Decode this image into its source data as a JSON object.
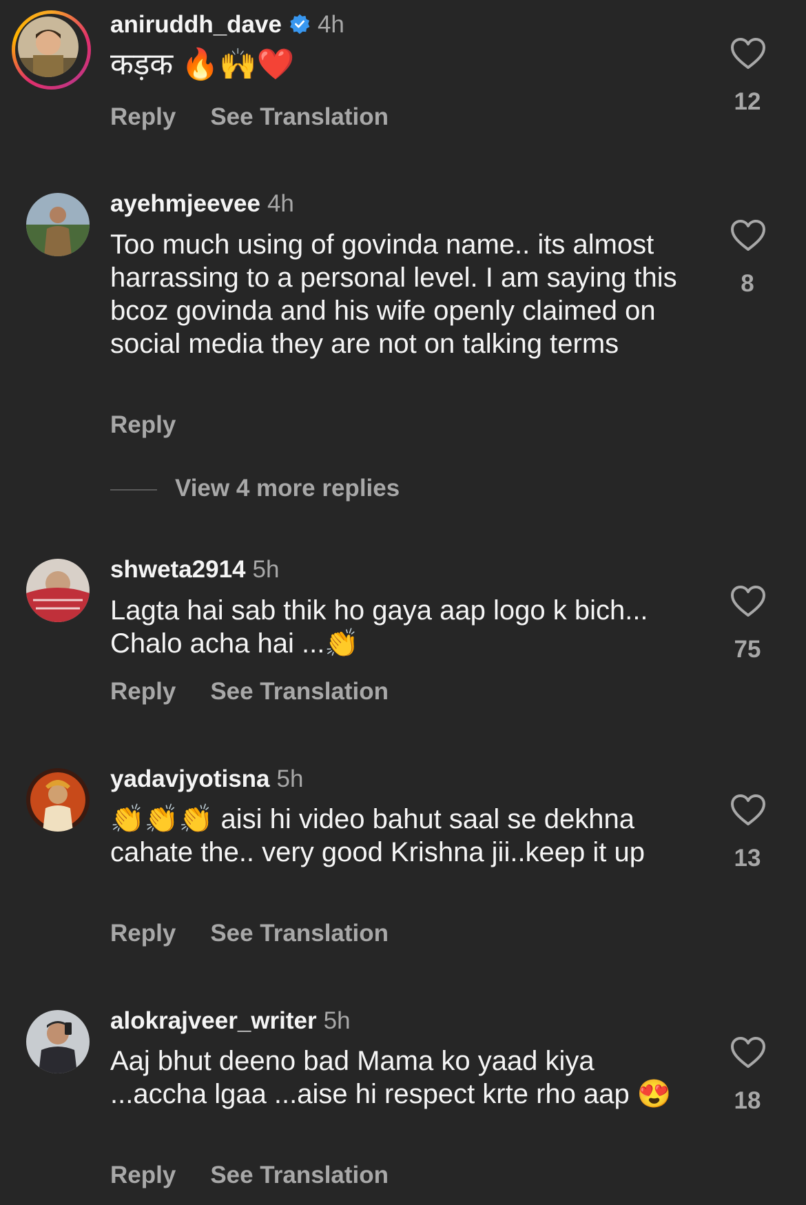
{
  "comments": [
    {
      "username": "aniruddh_dave",
      "verified": true,
      "time": "4h",
      "text": "कड़क 🔥🙌❤️",
      "actions": [
        "Reply",
        "See Translation"
      ],
      "likes": "12"
    },
    {
      "username": "ayehmjeevee",
      "verified": false,
      "time": "4h",
      "text": "Too much using of govinda name.. its almost harrassing to a personal level. I am saying this bcoz govinda and his wife openly claimed on social media they are not on talking terms",
      "actions": [
        "Reply"
      ],
      "likes": "8",
      "more_replies": "View 4 more replies"
    },
    {
      "username": "shweta2914",
      "verified": false,
      "time": "5h",
      "text": "Lagta hai sab thik ho gaya aap logo k bich... Chalo acha hai ...👏",
      "actions": [
        "Reply",
        "See Translation"
      ],
      "likes": "75"
    },
    {
      "username": "yadavjyotisna",
      "verified": false,
      "time": "5h",
      "text": "👏👏👏 aisi hi video bahut saal se dekhna cahate the.. very good Krishna jii..keep it up",
      "actions": [
        "Reply",
        "See Translation"
      ],
      "likes": "13"
    },
    {
      "username": "alokrajveer_writer",
      "verified": false,
      "time": "5h",
      "text": "Aaj bhut deeno bad Mama ko yaad kiya ...accha lgaa ...aise hi respect krte rho aap 😍",
      "actions": [
        "Reply",
        "See Translation"
      ],
      "likes": "18"
    }
  ],
  "icons": {
    "like": "heart-outline-icon",
    "verified": "verified-badge-icon"
  },
  "colors": {
    "background": "#262626",
    "secondary_text": "#a8a8a8",
    "verified": "#3897f0"
  }
}
